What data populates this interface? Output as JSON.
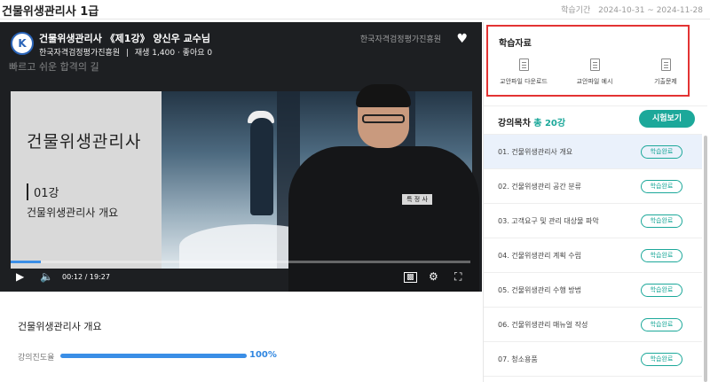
{
  "header": {
    "title": "건물위생관리사 1급",
    "period_label": "학습기간",
    "period_value": "2024-10-31 ~ 2024-11-28"
  },
  "video": {
    "logo": "K",
    "title": "건물위생관리사 《제1강》 양신우 교수님",
    "institute": "한국자격검정평가진흥원",
    "stats": "재생 1,400 · 좋아요 0",
    "watermark": "빠르고 쉬운 합격의 길",
    "brand": "한국자격검정평가진흥원",
    "slide_title": "건물위생관리사",
    "slide_lesson_num": "01강",
    "slide_lesson_title": "건물위생관리사 개요",
    "presenter_patch": "특 정 사",
    "current_time": "00:12",
    "duration": "19:27",
    "progress_fraction": 0.065
  },
  "lesson": {
    "title": "건물위생관리사 개요",
    "progress_label": "강의진도율",
    "progress_value": "100%",
    "progress_fraction": 1.0
  },
  "materials": {
    "title": "학습자료",
    "items": [
      {
        "label": "교안파일 다운로드"
      },
      {
        "label": "교안파일 예시"
      },
      {
        "label": "기출문제"
      }
    ]
  },
  "toc": {
    "title": "강의목차",
    "count": "총 20강",
    "exam_button": "시험보기",
    "items": [
      {
        "title": "01. 건물위생관리사 개요",
        "status": "학습완료"
      },
      {
        "title": "02. 건물위생관리 공간 분류",
        "status": "학습완료"
      },
      {
        "title": "03. 고객요구 및 관리 대상물 파악",
        "status": "학습완료"
      },
      {
        "title": "04. 건물위생관리 계획 수립",
        "status": "학습완료"
      },
      {
        "title": "05. 건물위생관리 수행 방법",
        "status": "학습완료"
      },
      {
        "title": "06. 건물위생관리 매뉴얼 작성",
        "status": "학습완료"
      },
      {
        "title": "07. 청소용품",
        "status": "학습완료"
      }
    ]
  },
  "colors": {
    "accent": "#1ca89a",
    "progress": "#3a8ee6",
    "highlight_border": "#e33333"
  }
}
